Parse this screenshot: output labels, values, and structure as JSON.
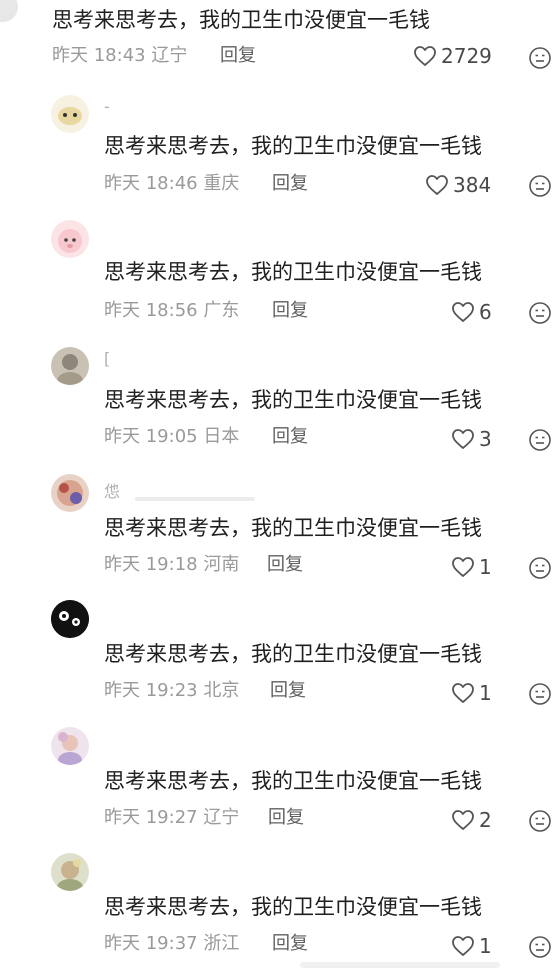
{
  "colors": {
    "text": "#1f1f1f",
    "meta": "#9a9a9a",
    "reply": "#5f5f5f",
    "like_icon": "#555555"
  },
  "icons": {
    "like": "heart-outline-icon",
    "more": "emoji-face-icon"
  },
  "top_comment": {
    "text": "思考来思考去，我的卫生巾没便宜一毛钱",
    "time_location": "昨天 18:43 辽宁",
    "reply_label": "回复",
    "likes": "2729"
  },
  "replies": [
    {
      "username": "-",
      "text": "思考来思考去，我的卫生巾没便宜一毛钱",
      "time_location": "昨天 18:46 重庆",
      "reply_label": "回复",
      "likes": "384"
    },
    {
      "username": "",
      "text": "思考来思考去，我的卫生巾没便宜一毛钱",
      "time_location": "昨天 18:56 广东",
      "reply_label": "回复",
      "likes": "6"
    },
    {
      "username": "[",
      "text": "思考来思考去，我的卫生巾没便宜一毛钱",
      "time_location": "昨天 19:05 日本",
      "reply_label": "回复",
      "likes": "3"
    },
    {
      "username": "怹",
      "text": "思考来思考去，我的卫生巾没便宜一毛钱",
      "time_location": "昨天 19:18 河南",
      "reply_label": "回复",
      "likes": "1"
    },
    {
      "username": "",
      "text": "思考来思考去，我的卫生巾没便宜一毛钱",
      "time_location": "昨天 19:23 北京",
      "reply_label": "回复",
      "likes": "1"
    },
    {
      "username": "",
      "text": "思考来思考去，我的卫生巾没便宜一毛钱",
      "time_location": "昨天 19:27 辽宁",
      "reply_label": "回复",
      "likes": "2"
    },
    {
      "username": "",
      "text": "思考来思考去，我的卫生巾没便宜一毛钱",
      "time_location": "昨天 19:37 浙江",
      "reply_label": "回复",
      "likes": "1"
    }
  ]
}
